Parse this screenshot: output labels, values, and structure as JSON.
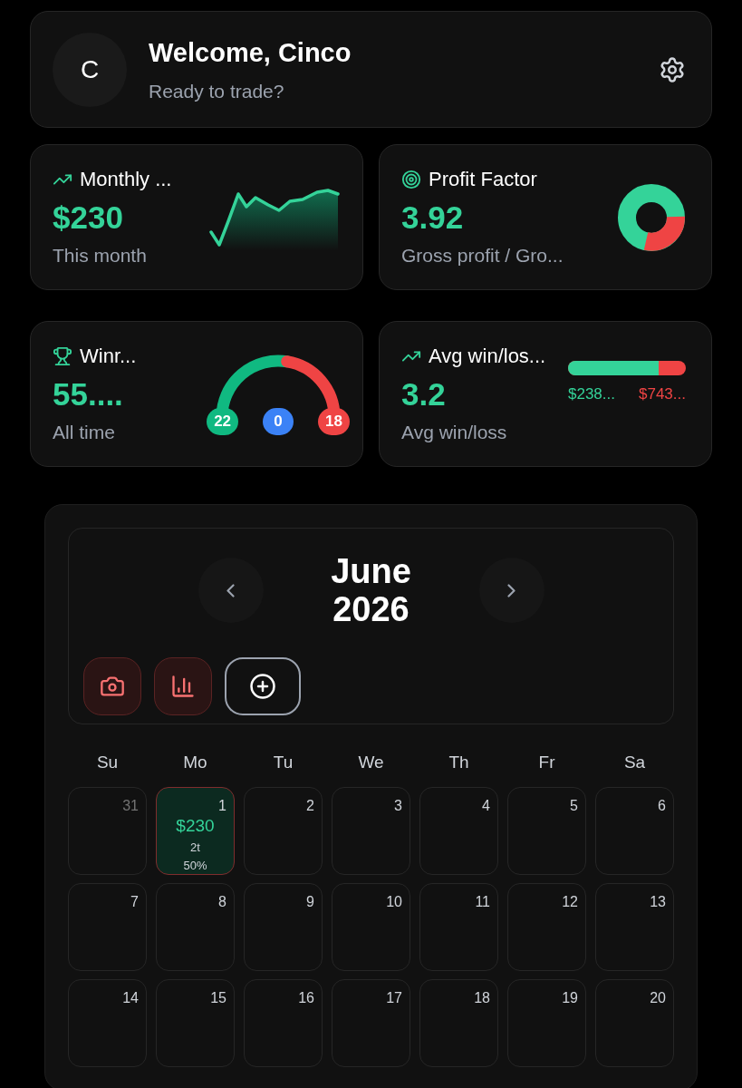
{
  "header": {
    "avatar_letter": "C",
    "title": "Welcome, Cinco",
    "subtitle": "Ready to trade?"
  },
  "stats": [
    {
      "kind": "sparkline",
      "title": "Monthly ...",
      "value": "$230",
      "caption": "This month"
    },
    {
      "kind": "donut",
      "title": "Profit Factor",
      "value": "3.92",
      "caption": "Gross profit / Gro..."
    },
    {
      "kind": "gauge",
      "title": "Winr...",
      "value": "55....",
      "caption": "All time",
      "badges": [
        {
          "text": "22",
          "color": "#10b981"
        },
        {
          "text": "0",
          "color": "#3b82f6"
        },
        {
          "text": "18",
          "color": "#ef4444"
        }
      ]
    },
    {
      "kind": "bar",
      "title": "Avg win/los...",
      "value": "3.2",
      "caption": "Avg win/loss",
      "level": 0.77,
      "win": "$238...",
      "loss": "$743..."
    }
  ],
  "calendar": {
    "month": "June",
    "year": "2026",
    "weekdays": [
      "Su",
      "Mo",
      "Tu",
      "We",
      "Th",
      "Fr",
      "Sa"
    ],
    "weeks": [
      [
        {
          "day": "31",
          "outside": true,
          "selected": false
        },
        {
          "day": "1",
          "outside": false,
          "selected": true,
          "pnl": "$230",
          "trades": "2t",
          "winrate": "50%"
        },
        {
          "day": "2",
          "outside": false,
          "selected": false
        },
        {
          "day": "3",
          "outside": false,
          "selected": false
        },
        {
          "day": "4",
          "outside": false,
          "selected": false
        },
        {
          "day": "5",
          "outside": false,
          "selected": false
        },
        {
          "day": "6",
          "outside": false,
          "selected": false
        }
      ],
      [
        {
          "day": "7",
          "outside": false,
          "selected": false
        },
        {
          "day": "8",
          "outside": false,
          "selected": false
        },
        {
          "day": "9",
          "outside": false,
          "selected": false
        },
        {
          "day": "10",
          "outside": false,
          "selected": false
        },
        {
          "day": "11",
          "outside": false,
          "selected": false
        },
        {
          "day": "12",
          "outside": false,
          "selected": false
        },
        {
          "day": "13",
          "outside": false,
          "selected": false
        }
      ],
      [
        {
          "day": "14",
          "outside": false,
          "selected": false
        },
        {
          "day": "15",
          "outside": false,
          "selected": false
        },
        {
          "day": "16",
          "outside": false,
          "selected": false
        },
        {
          "day": "17",
          "outside": false,
          "selected": false
        },
        {
          "day": "18",
          "outside": false,
          "selected": false
        },
        {
          "day": "19",
          "outside": false,
          "selected": false
        },
        {
          "day": "20",
          "outside": false,
          "selected": false
        }
      ]
    ]
  }
}
